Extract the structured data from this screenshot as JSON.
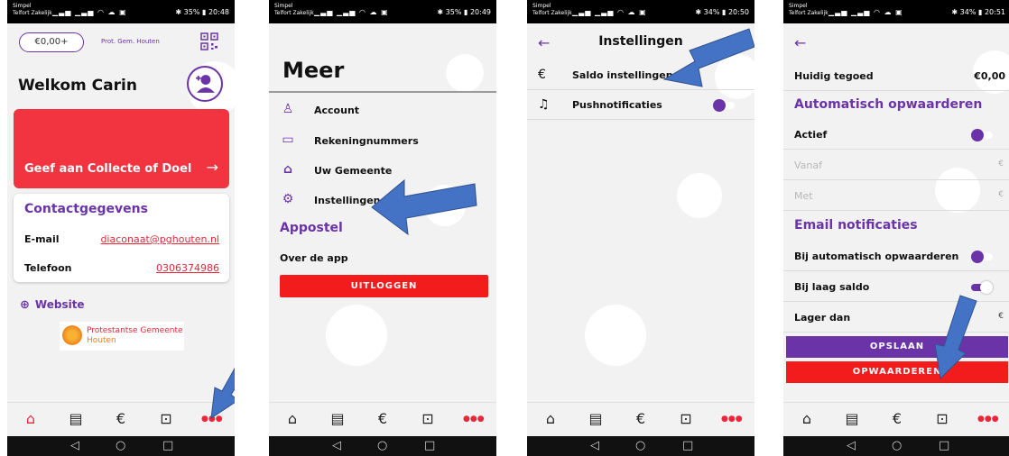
{
  "screens": [
    {
      "status": {
        "carrier": "Simpel\nTelfort Zakelijk",
        "battery": "✱ 35% ▮ 20:48"
      },
      "saldo": "€0,00+",
      "church_name": "Prot. Gem. Houten",
      "welcome": "Welkom Carin",
      "donate_card_label": "Geef aan Collecte of Doel",
      "contact": {
        "title": "Contactgegevens",
        "email_label": "E-mail",
        "email_value": "diaconaat@pghouten.nl",
        "phone_label": "Telefoon",
        "phone_value": "0306374986"
      },
      "website_label": "Website",
      "logo": {
        "line1": "Protestantse Gemeente",
        "line2": "Houten"
      }
    },
    {
      "status": {
        "carrier": "Simpel\nTelfort Zakelijk",
        "battery": "✱ 35% ▮ 20:49"
      },
      "title": "Meer",
      "items": [
        "Account",
        "Rekeningnummers",
        "Uw Gemeente",
        "Instellingen"
      ],
      "section": "Appostel",
      "about": "Over de app",
      "logout": "UITLOGGEN"
    },
    {
      "status": {
        "carrier": "Simpel\nTelfort Zakelijk",
        "battery": "✱ 34% ▮ 20:50"
      },
      "title": "Instellingen",
      "rows": [
        "Saldo instellingen",
        "Pushnotificaties"
      ],
      "push_enabled": true
    },
    {
      "status": {
        "carrier": "Simpel\nTelfort Zakelijk",
        "battery": "✱ 34% ▮ 20:51"
      },
      "huidig_label": "Huidig tegoed",
      "huidig_value": "€0,00",
      "auto_section": "Automatisch opwaarderen",
      "actief_label": "Actief",
      "actief_on": false,
      "vanaf_label": "Vanaf",
      "met_label": "Met",
      "currency": "€",
      "email_section": "Email notificaties",
      "bij_auto_label": "Bij automatisch opwaarderen",
      "bij_auto_on": false,
      "bij_laag_label": "Bij laag saldo",
      "bij_laag_on": true,
      "lager_label": "Lager dan",
      "save_button": "OPSLAAN",
      "topup_button": "OPWAARDEREN"
    }
  ],
  "colors": {
    "purple": "#6a34a8",
    "red": "#f23440",
    "button_red": "#f21c1c",
    "arrow_blue": "#4472c4"
  }
}
